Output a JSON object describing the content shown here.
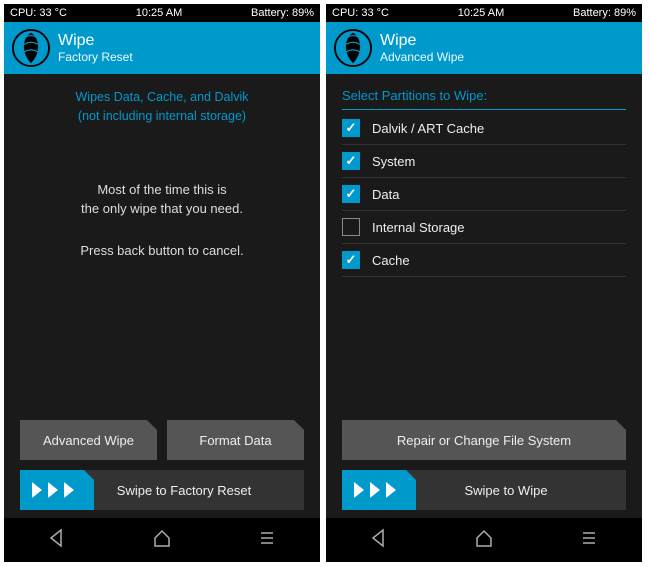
{
  "status": {
    "cpu": "CPU: 33 °C",
    "time": "10:25 AM",
    "battery": "Battery: 89%"
  },
  "left": {
    "title": "Wipe",
    "subtitle": "Factory Reset",
    "info1": "Wipes Data, Cache, and Dalvik",
    "info2": "(not including internal storage)",
    "msg1a": "Most of the time this is",
    "msg1b": "the only wipe that you need.",
    "msg2": "Press back button to cancel.",
    "btn_adv": "Advanced Wipe",
    "btn_fmt": "Format Data",
    "swipe": "Swipe to Factory Reset"
  },
  "right": {
    "title": "Wipe",
    "subtitle": "Advanced Wipe",
    "section": "Select Partitions to Wipe:",
    "items": {
      "0": "Dalvik / ART Cache",
      "1": "System",
      "2": "Data",
      "3": "Internal Storage",
      "4": "Cache"
    },
    "checked": [
      true,
      true,
      true,
      false,
      true
    ],
    "btn_repair": "Repair or Change File System",
    "swipe": "Swipe to Wipe"
  }
}
